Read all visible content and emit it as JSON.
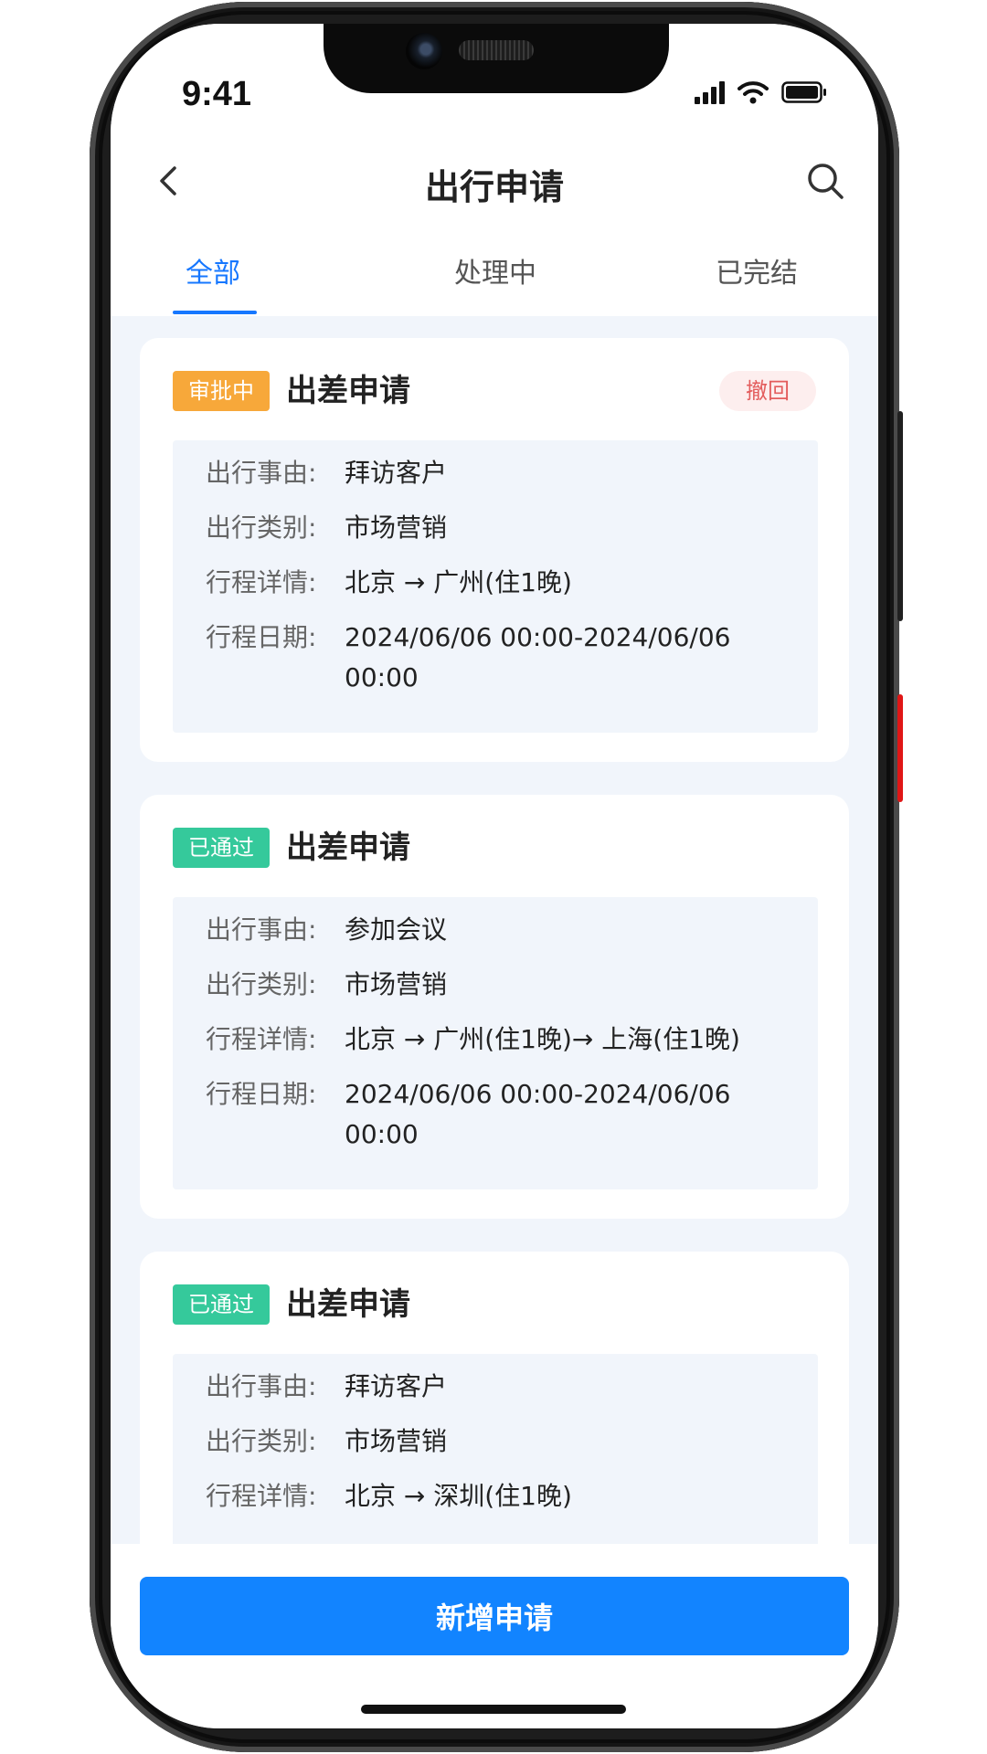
{
  "status_bar": {
    "time": "9:41"
  },
  "header": {
    "title": "出行申请",
    "back_icon": "chevron-left-icon",
    "search_icon": "search-icon"
  },
  "tabs": [
    {
      "label": "全部",
      "active": true
    },
    {
      "label": "处理中",
      "active": false
    },
    {
      "label": "已完结",
      "active": false
    }
  ],
  "colors": {
    "accent": "#1677ff",
    "pending_tag": "#f7a83a",
    "approved_tag": "#35c99b",
    "withdraw_text": "#e35d5d",
    "withdraw_bg": "#fdeeee"
  },
  "field_labels": {
    "reason": "出行事由:",
    "category": "出行类别:",
    "itinerary": "行程详情:",
    "dates": "行程日期:"
  },
  "cards": [
    {
      "status": "审批中",
      "title": "出差申请",
      "action": "撤回",
      "reason": "拜访客户",
      "category": "市场营销",
      "itinerary": "北京 → 广州(住1晚)",
      "dates": "2024/06/06 00:00-2024/06/06 00:00"
    },
    {
      "status": "已通过",
      "title": "出差申请",
      "reason": "参加会议",
      "category": "市场营销",
      "itinerary": "北京 → 广州(住1晚)→ 上海(住1晚)",
      "dates": "2024/06/06 00:00-2024/06/06 00:00"
    },
    {
      "status": "已通过",
      "title": "出差申请",
      "reason": "拜访客户",
      "category": "市场营销",
      "itinerary": "北京 → 深圳(住1晚)"
    }
  ],
  "bottom": {
    "button_label": "新增申请"
  }
}
